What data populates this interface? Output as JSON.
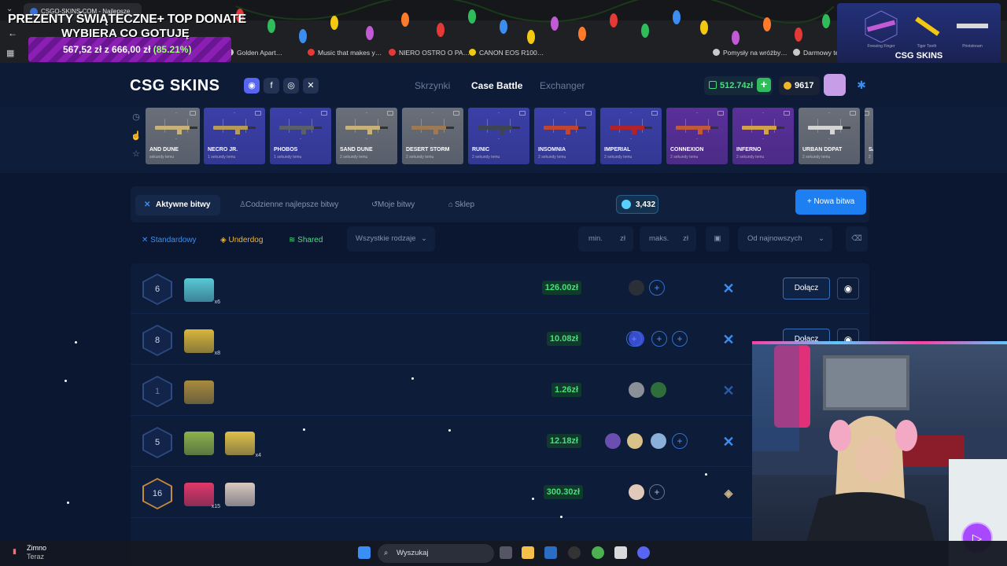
{
  "browser": {
    "tab_title": "CSGO-SKINS.COM - Najlepsze",
    "bookmarks": [
      {
        "label": "Golden Apart…",
        "color": "#c9c9c9"
      },
      {
        "label": "Music that makes y…",
        "color": "#e53935"
      },
      {
        "label": "NIERO OSTRO O PA…",
        "color": "#e53935"
      },
      {
        "label": "CANON EOS R100…",
        "color": "#f2c811"
      },
      {
        "label": "Pomysły na wróżby…",
        "color": "#c9c9c9"
      },
      {
        "label": "Darmowy te",
        "color": "#c9c9c9"
      }
    ]
  },
  "donate_overlay": {
    "title": "PREZENTY ŚWIĄTECZNE+ TOP DONATE",
    "subtitle": "WYBIERA CO GOTUJĘ",
    "amount": "567,52 zł z 666,00 zł",
    "percent": "(85.21%)",
    "progress_fraction": 0.8521
  },
  "stream_overlay": {
    "logo": "CSG SKINS",
    "items": [
      "Freezing Finger",
      "Tiger Tooth",
      "Printstream"
    ]
  },
  "header": {
    "logo": "CSG SKINS",
    "nav": [
      {
        "label": "Skrzynki",
        "state": "dim"
      },
      {
        "label": "Case Battle",
        "state": "active"
      },
      {
        "label": "Exchanger",
        "state": "dim"
      }
    ],
    "balance": "512.74zł",
    "coins": "9617"
  },
  "live_drops": [
    {
      "name": "AND DUNE",
      "time": "sekundy temu",
      "bg": "#6a6f78",
      "gun": "#c8b27a"
    },
    {
      "name": "NECRO JR.",
      "time": "1 sekundy temu",
      "bg": "#3b3fa8",
      "gun": "#b59a5a"
    },
    {
      "name": "PHOBOS",
      "time": "1 sekundy temu",
      "bg": "#3b3fa8",
      "gun": "#5b5f6a"
    },
    {
      "name": "SAND DUNE",
      "time": "2 sekundy temu",
      "bg": "#6a6f78",
      "gun": "#c8b27a"
    },
    {
      "name": "DESERT STORM",
      "time": "2 sekundy temu",
      "bg": "#6a6f78",
      "gun": "#9b7a55"
    },
    {
      "name": "RUNIC",
      "time": "2 sekundy temu",
      "bg": "#3b3fa8",
      "gun": "#3e4552"
    },
    {
      "name": "INSOMNIA",
      "time": "2 sekundy temu",
      "bg": "#3b3fa8",
      "gun": "#c2452f"
    },
    {
      "name": "IMPERIAL",
      "time": "2 sekundy temu",
      "bg": "#3b3fa8",
      "gun": "#b2222a"
    },
    {
      "name": "CONNEXION",
      "time": "2 sekundy temu",
      "bg": "#5a2f9a",
      "gun": "#c05a3a"
    },
    {
      "name": "INFERNO",
      "time": "2 sekundy temu",
      "bg": "#5a2f9a",
      "gun": "#d1a24a"
    },
    {
      "name": "URBAN DDPAT",
      "time": "2 sekundy temu",
      "bg": "#6a6f78",
      "gun": "#d4d4d4"
    },
    {
      "name": "SA",
      "time": "2",
      "bg": "#6a6f78",
      "gun": "#c8b27a"
    }
  ],
  "battle_tabs": {
    "tabs": [
      "Aktywne bitwy",
      "Codzienne najlepsze bitwy",
      "Moje bitwy",
      "Sklep"
    ],
    "gems": "3,432",
    "new_battle": "Nowa bitwa"
  },
  "filters": {
    "modes": [
      {
        "label": "Standardowy",
        "color": "#3b8df0"
      },
      {
        "label": "Underdog",
        "color": "#f1b52a"
      },
      {
        "label": "Shared",
        "color": "#46e07a"
      }
    ],
    "type_select": "Wszystkie rodzaje",
    "min_placeholder": "min.",
    "max_placeholder": "maks.",
    "currency": "zł",
    "sort_select": "Od najnowszych"
  },
  "battles": [
    {
      "rounds": "6",
      "style": "",
      "cases": [
        {
          "color": "#59c8d4",
          "count": "x6"
        }
      ],
      "price": "126.00zł",
      "players": [
        "#2a2f38"
      ],
      "slots": 1,
      "slot_style": "",
      "mode": "standard",
      "action": "Dołącz"
    },
    {
      "rounds": "8",
      "style": "",
      "cases": [
        {
          "color": "#d9b63a",
          "count": "x8"
        }
      ],
      "price": "10.08zł",
      "players": [
        "#3b4bd0"
      ],
      "slots": 3,
      "slot_style": "",
      "mode": "standard",
      "action": "Dołącz"
    },
    {
      "rounds": "1",
      "style": "dim",
      "cases": [
        {
          "color": "#a88b3e",
          "count": ""
        }
      ],
      "price": "1.26zł",
      "players": [
        "#8a8f98",
        "#2f6e3b"
      ],
      "slots": 0,
      "slot_style": "",
      "mode": "standard-dim",
      "action": ""
    },
    {
      "rounds": "5",
      "style": "",
      "cases": [
        {
          "color": "#8cb24a",
          "count": ""
        },
        {
          "color": "#e0c04a",
          "count": "x4"
        }
      ],
      "price": "12.18zł",
      "players": [
        "#6a4fb0",
        "#d9c28a",
        "#8ab0d9"
      ],
      "slots": 1,
      "slot_style": "",
      "mode": "standard",
      "action": ""
    },
    {
      "rounds": "16",
      "style": "gold",
      "cases": [
        {
          "color": "#e0386a",
          "count": "x15"
        },
        {
          "color": "#d9c8c0",
          "count": ""
        }
      ],
      "price": "300.30zł",
      "players": [
        "#e0c9b8"
      ],
      "slots": 1,
      "slot_style": "gray",
      "mode": "underdog",
      "action": ""
    }
  ],
  "taskbar": {
    "weather_temp": "Zimno",
    "weather_sub": "Teraz",
    "search_placeholder": "Wyszukaj"
  }
}
